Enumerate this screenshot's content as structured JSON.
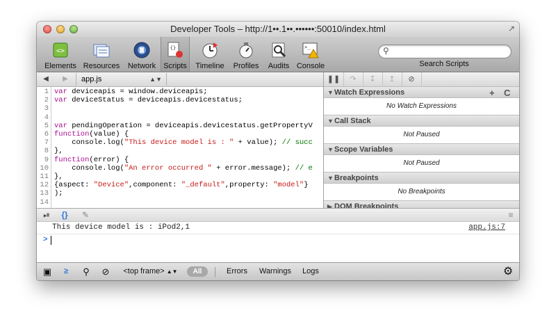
{
  "window": {
    "title": "Developer Tools – http://1••.1••.••••••:50010/index.html"
  },
  "toolbar": {
    "tools": [
      "Elements",
      "Resources",
      "Network",
      "Scripts",
      "Timeline",
      "Profiles",
      "Audits",
      "Console"
    ],
    "search_label": "Search Scripts",
    "search_placeholder": ""
  },
  "scripts": {
    "file": "app.js",
    "lines": [
      {
        "n": "1",
        "t": "var deviceapis = window.deviceapis;"
      },
      {
        "n": "2",
        "t": "var deviceStatus = deviceapis.devicestatus;"
      },
      {
        "n": "3",
        "t": ""
      },
      {
        "n": "4",
        "t": ""
      },
      {
        "n": "5",
        "t": "var pendingOperation = deviceapis.devicestatus.getPropertyV"
      },
      {
        "n": "6",
        "t": "function(value) {"
      },
      {
        "n": "7",
        "t": "    console.log(\"This device model is : \" + value); // succ"
      },
      {
        "n": "8",
        "t": "},"
      },
      {
        "n": "9",
        "t": "function(error) {"
      },
      {
        "n": "10",
        "t": "    console.log(\"An error occurred \" + error.message); // e"
      },
      {
        "n": "11",
        "t": "},"
      },
      {
        "n": "12",
        "t": "{aspect: \"Device\",component: \"_default\",property: \"model\"} "
      },
      {
        "n": "13",
        "t": ");"
      },
      {
        "n": "14",
        "t": ""
      }
    ]
  },
  "sidebar": {
    "sections": [
      {
        "title": "Watch Expressions",
        "body": "No Watch Expressions",
        "add": "+",
        "refresh": "C"
      },
      {
        "title": "Call Stack",
        "body": "Not Paused"
      },
      {
        "title": "Scope Variables",
        "body": "Not Paused"
      },
      {
        "title": "Breakpoints",
        "body": "No Breakpoints"
      },
      {
        "title": "DOM Breakpoints",
        "body": ""
      }
    ]
  },
  "console": {
    "log_message": "This device model is : iPod2,1",
    "log_source": "app.js:7",
    "prompt": ">"
  },
  "statusbar": {
    "frame": "<top frame>",
    "filter_all": "All",
    "filter_errors": "Errors",
    "filter_warnings": "Warnings",
    "filter_logs": "Logs"
  }
}
